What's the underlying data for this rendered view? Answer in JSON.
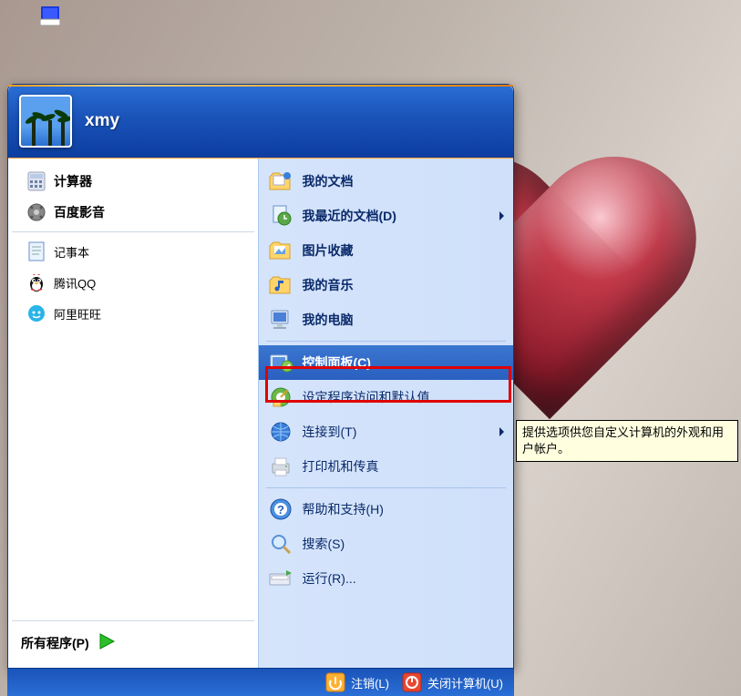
{
  "user": {
    "name": "xmy"
  },
  "left": {
    "pinned": [
      {
        "label": "计算器",
        "icon": "calculator-icon"
      },
      {
        "label": "百度影音",
        "icon": "media-icon"
      }
    ],
    "recent": [
      {
        "label": "记事本",
        "icon": "notepad-icon"
      },
      {
        "label": "腾讯QQ",
        "icon": "qq-icon"
      },
      {
        "label": "阿里旺旺",
        "icon": "wangwang-icon"
      }
    ],
    "all_programs": "所有程序(P)"
  },
  "right": {
    "groups": [
      [
        {
          "label": "我的文档",
          "icon": "folder-docs-icon",
          "submenu": false
        },
        {
          "label": "我最近的文档(D)",
          "icon": "recent-docs-icon",
          "submenu": true
        },
        {
          "label": "图片收藏",
          "icon": "folder-pictures-icon",
          "submenu": false
        },
        {
          "label": "我的音乐",
          "icon": "folder-music-icon",
          "submenu": false
        },
        {
          "label": "我的电脑",
          "icon": "computer-icon",
          "submenu": false
        }
      ],
      [
        {
          "label": "控制面板(C)",
          "icon": "control-panel-icon",
          "submenu": false,
          "selected": true
        },
        {
          "label": "设定程序访问和默认值",
          "icon": "program-access-icon",
          "submenu": false
        },
        {
          "label": "连接到(T)",
          "icon": "network-icon",
          "submenu": true
        },
        {
          "label": "打印机和传真",
          "icon": "printer-icon",
          "submenu": false
        }
      ],
      [
        {
          "label": "帮助和支持(H)",
          "icon": "help-icon",
          "submenu": false
        },
        {
          "label": "搜索(S)",
          "icon": "search-icon",
          "submenu": false
        },
        {
          "label": "运行(R)...",
          "icon": "run-icon",
          "submenu": false
        }
      ]
    ]
  },
  "footer": {
    "logoff": "注销(L)",
    "shutdown": "关闭计算机(U)"
  },
  "tooltip": "提供选项供您自定义计算机的外观和用户帐户。",
  "colors": {
    "header_blue": "#1a53b8",
    "select_blue": "#2a60c0",
    "right_bg": "#d5e4fb",
    "highlight_red": "#e00000",
    "tooltip_bg": "#ffffe0"
  }
}
